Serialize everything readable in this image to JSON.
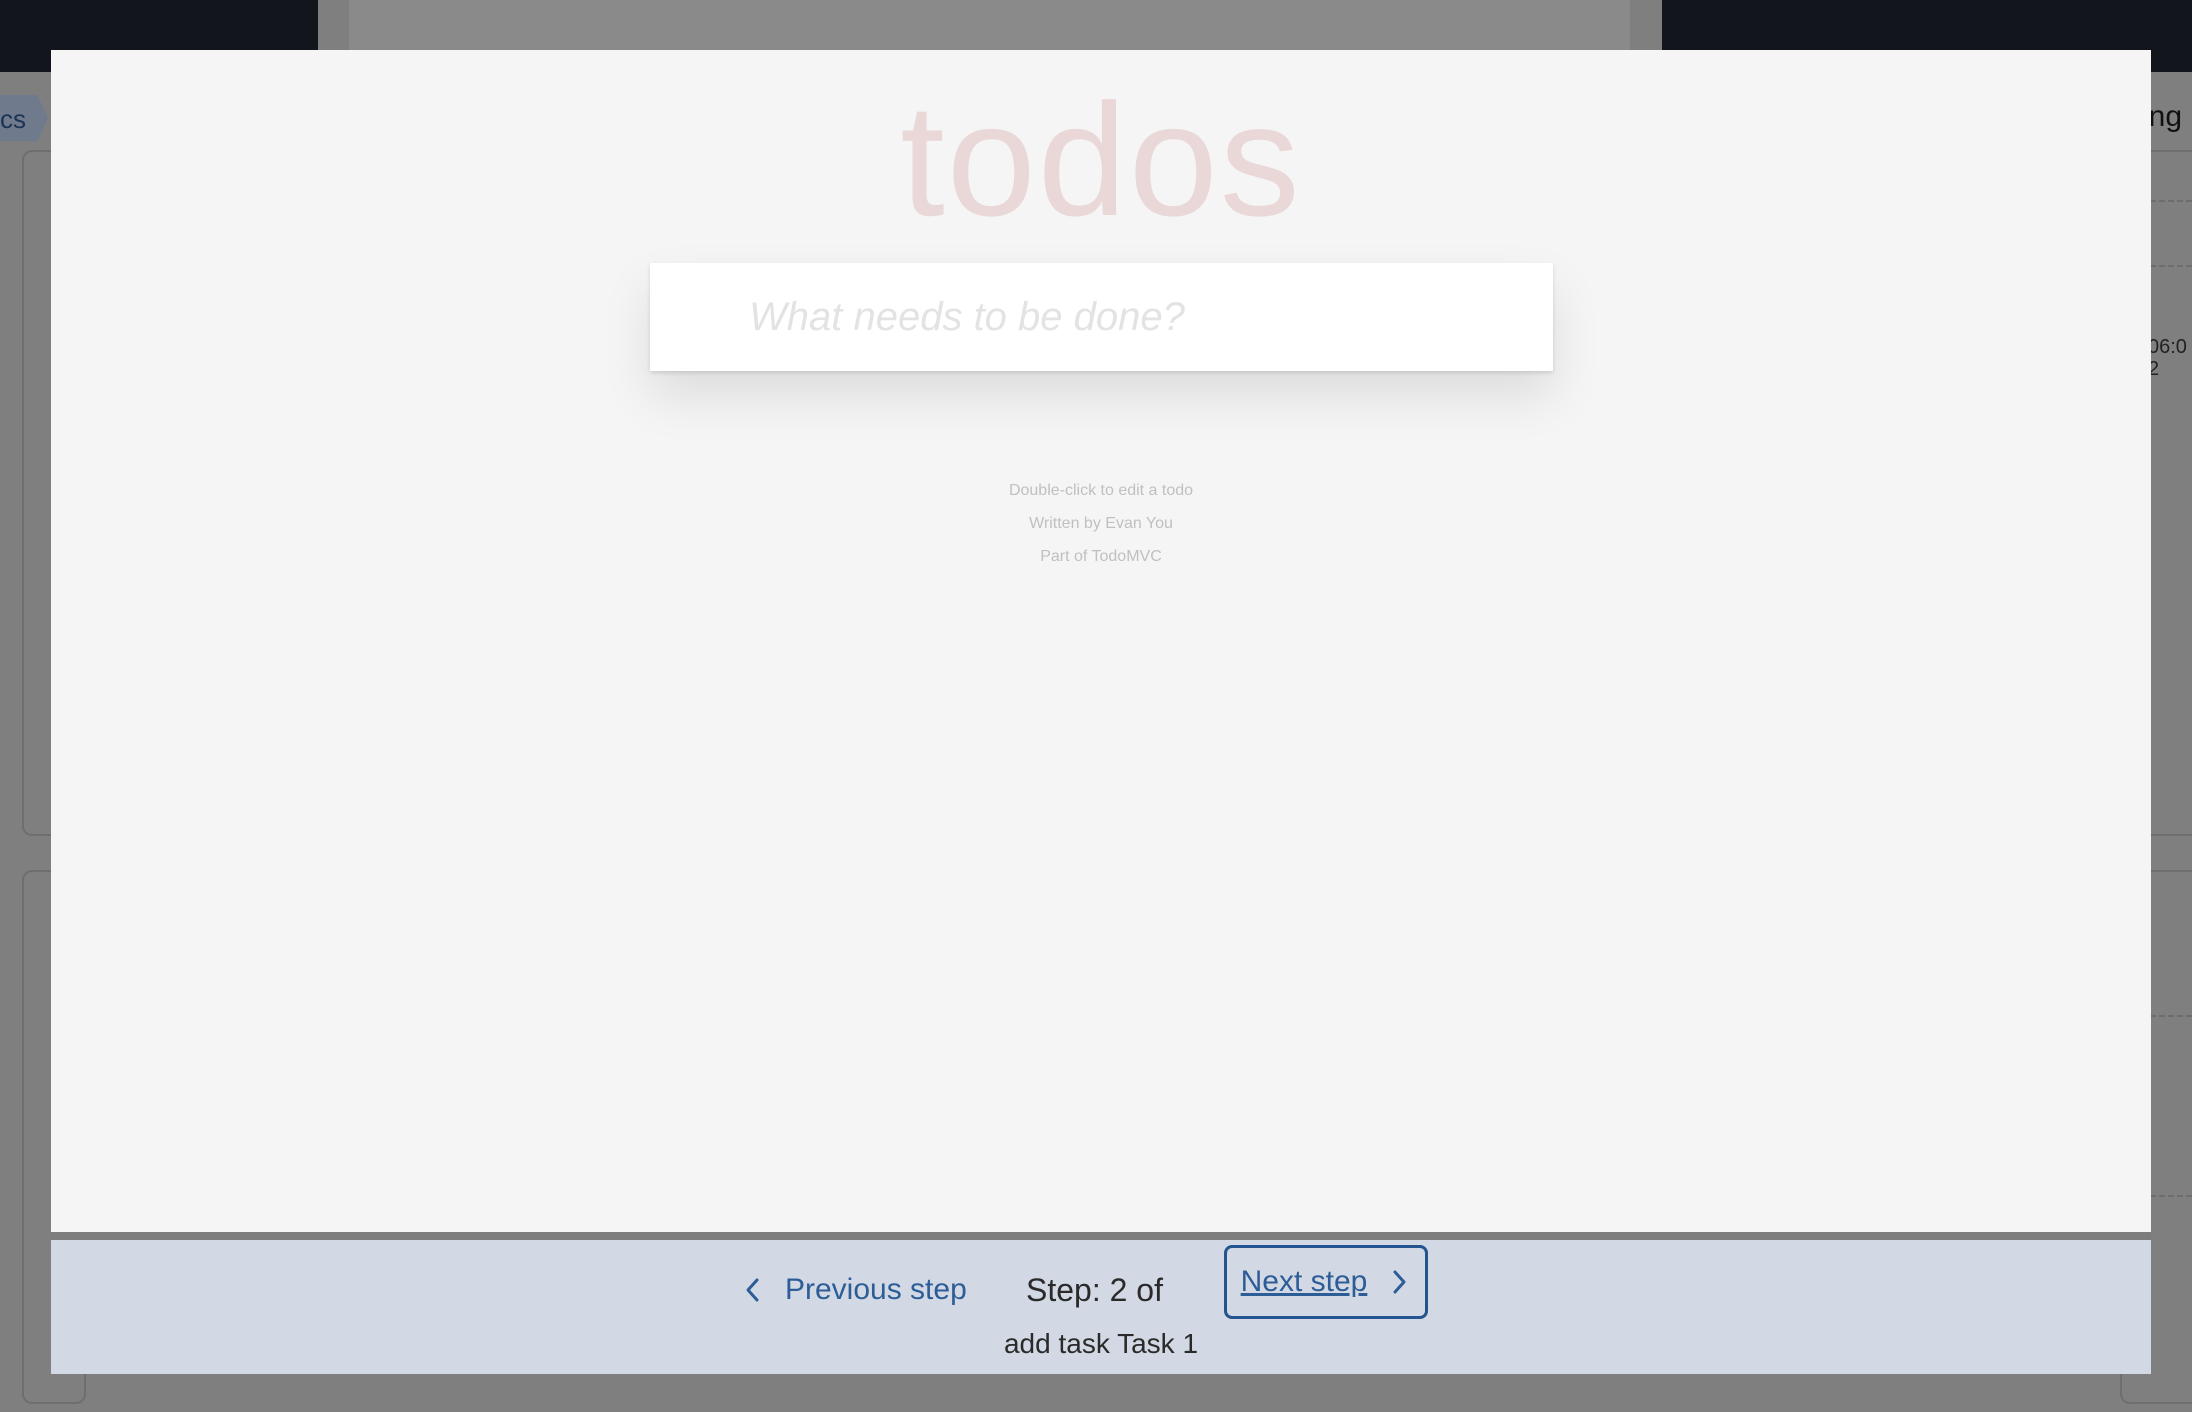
{
  "background": {
    "breadcrumb_fragment": "cs",
    "right_header_fragment": "ing",
    "right_time_fragment_line1": "06:0",
    "right_time_fragment_line2": "2"
  },
  "todo_app": {
    "title": "todos",
    "new_todo_placeholder": "What needs to be done?",
    "info": {
      "edit_hint": "Double-click to edit a todo",
      "author": "Written by Evan You",
      "part_of": "Part of TodoMVC"
    },
    "colors": {
      "title": "#ead7d7",
      "background": "#f5f5f5"
    }
  },
  "step_nav": {
    "previous_label": "Previous step",
    "step_label": "Step: 2 of",
    "next_label": "Next step",
    "step_description": "add task Task 1",
    "icons": {
      "previous": "chevron-left-icon",
      "next": "chevron-right-icon"
    },
    "colors": {
      "link": "#2c5d96",
      "footer_bg": "#d3d9e4",
      "focus_border": "#24548f"
    }
  }
}
